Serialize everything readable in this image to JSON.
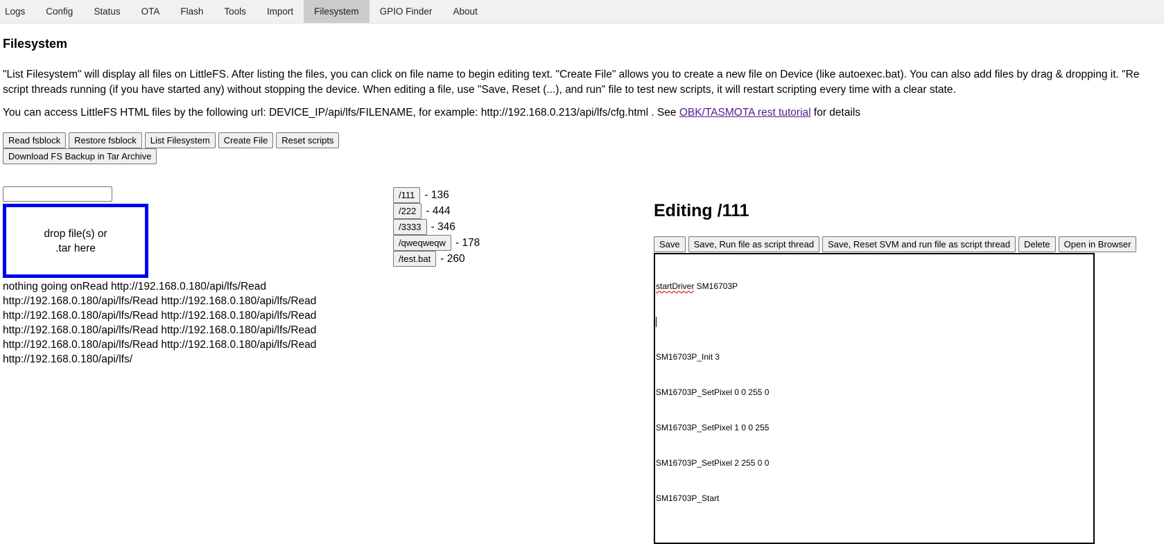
{
  "nav": {
    "tabs": [
      "Logs",
      "Config",
      "Status",
      "OTA",
      "Flash",
      "Tools",
      "Import",
      "Filesystem",
      "GPIO Finder",
      "About"
    ],
    "active_tab": "Filesystem"
  },
  "page": {
    "title": "Filesystem",
    "intro_line1": "\"List Filesystem\" will display all files on LittleFS. After listing the files, you can click on file name to begin editing text. \"Create File\" allows you to create a new file on Device (like autoexec.bat). You can also add files by drag & dropping it. \"Re",
    "intro_line2": "script threads running (if you have started any) without stopping the device. When editing a file, use \"Save, Reset (...), and run\" file to test new scripts, it will restart scripting every time with a clear state.",
    "url_text": "You can access LittleFS HTML files by the following url: DEVICE_IP/api/lfs/FILENAME, for example: http://192.168.0.213/api/lfs/cfg.html . See ",
    "link_text": "OBK/TASMOTA rest tutorial",
    "url_suffix": " for details"
  },
  "actions": {
    "read_fsblock": "Read fsblock",
    "restore_fsblock": "Restore fsblock",
    "list_filesystem": "List Filesystem",
    "create_file": "Create File",
    "reset_scripts": "Reset scripts",
    "download_backup": "Download FS Backup in Tar Archive"
  },
  "upload": {
    "input_value": "",
    "drop_line1": "drop file(s) or",
    "drop_line2": ".tar here"
  },
  "log_text": "nothing going onRead http://192.168.0.180/api/lfs/Read http://192.168.0.180/api/lfs/Read http://192.168.0.180/api/lfs/Read http://192.168.0.180/api/lfs/Read http://192.168.0.180/api/lfs/Read http://192.168.0.180/api/lfs/Read http://192.168.0.180/api/lfs/Read http://192.168.0.180/api/lfs/Read http://192.168.0.180/api/lfs/Read http://192.168.0.180/api/lfs/",
  "files": [
    {
      "name": "/111",
      "size": "- 136"
    },
    {
      "name": "/222",
      "size": "- 444"
    },
    {
      "name": "/3333",
      "size": "- 346"
    },
    {
      "name": "/qweqweqw",
      "size": "- 178"
    },
    {
      "name": "/test.bat",
      "size": "- 260"
    }
  ],
  "editor": {
    "title": "Editing /111",
    "buttons": {
      "save": "Save",
      "save_run": "Save, Run file as script thread",
      "save_reset_run": "Save, Reset SVM and run file as script thread",
      "delete": "Delete",
      "open_browser": "Open in Browser"
    },
    "line1_word1": "startDriver",
    "line1_rest": " SM16703P",
    "lines": [
      "SM16703P_Init 3",
      "SM16703P_SetPixel 0 0 255 0",
      "SM16703P_SetPixel 1 0 0 255",
      "SM16703P_SetPixel 2 255 0 0",
      "SM16703P_Start"
    ]
  }
}
